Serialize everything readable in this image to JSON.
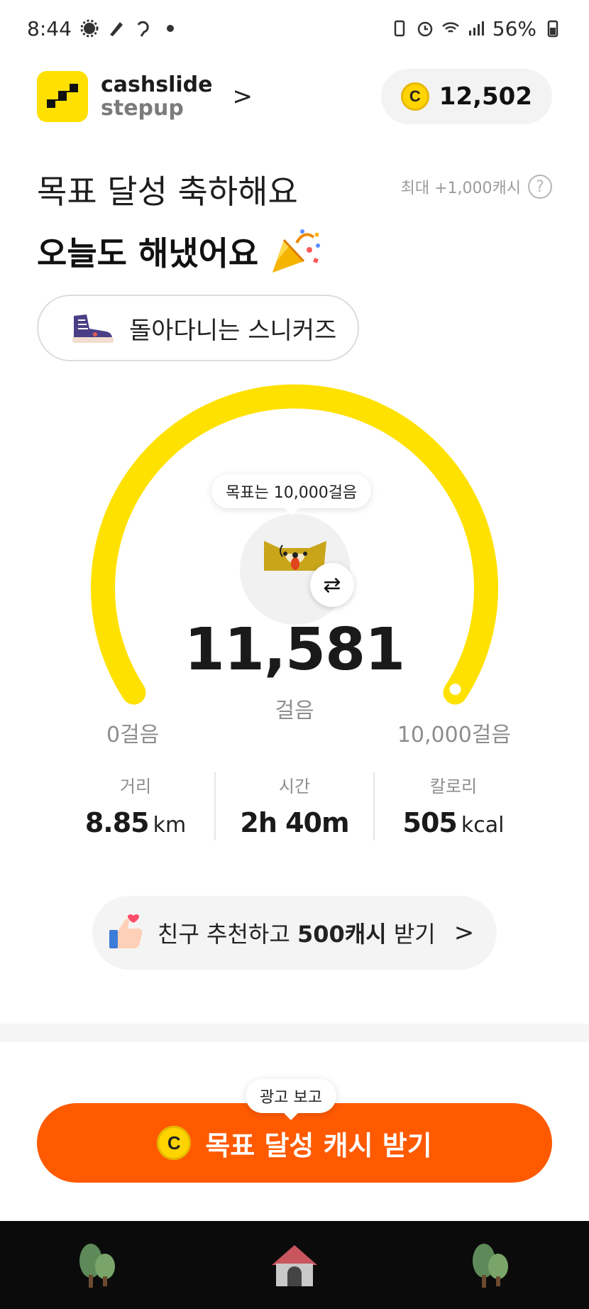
{
  "status_bar": {
    "time": "8:44",
    "battery": "56%"
  },
  "header": {
    "brand_line1": "cashslide",
    "brand_line2": "stepup",
    "brand_chevron": ">",
    "coin_symbol": "C",
    "coin_balance": "12,502"
  },
  "title": {
    "line1": "목표 달성 축하해요",
    "line2": "오늘도 해냈어요",
    "max_cash": "최대 +1,000캐시",
    "help": "?"
  },
  "shoe": {
    "label": "돌아다니는 스니커즈"
  },
  "gauge": {
    "goal_tooltip": "목표는 10,000걸음",
    "steps": "11,581",
    "steps_unit": "걸음",
    "min_label": "0걸음",
    "max_label": "10,000걸음",
    "progress": 1.0,
    "color": "#ffe100",
    "swap_icon": "⇄"
  },
  "stats": [
    {
      "label": "거리",
      "value": "8.85",
      "unit": "km"
    },
    {
      "label": "시간",
      "value": "2h 40m",
      "unit": ""
    },
    {
      "label": "칼로리",
      "value": "505",
      "unit": "kcal"
    }
  ],
  "refer": {
    "text_before": "친구 추천하고 ",
    "text_bold": "500캐시",
    "text_after": " 받기",
    "chevron": ">"
  },
  "cta": {
    "tooltip": "광고 보고",
    "coin_symbol": "C",
    "label": "목표 달성 캐시 받기",
    "color": "#ff5a00"
  },
  "navbar": {
    "items": [
      "tree-left-icon",
      "house-icon",
      "tree-right-icon"
    ]
  }
}
